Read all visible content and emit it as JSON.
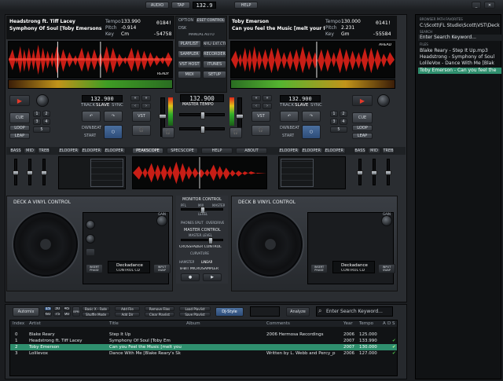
{
  "topbar": {
    "audio": "AUDIO",
    "tap": "TAP",
    "bpm": "132.9",
    "help": "HELP"
  },
  "deckA": {
    "artist": "Headstrong ft. Tiff Lacey",
    "title": "Symphony Of Soul [Toby Emersons Elec",
    "tempo_label": "Tempo",
    "tempo_value": "133.990",
    "pitch_label": "Pitch",
    "pitch_value": "-0.914",
    "key_label": "Key",
    "key_value": "Cm",
    "time1": "0184!",
    "time2": "-54758",
    "ready": "READY",
    "bpm_display": "132.900",
    "track": "TRACK",
    "slave": "SLAVE",
    "sync": "SYNC",
    "cue": "CUE",
    "loop": "LOOP",
    "leap": "LEAP",
    "downbeat": "DWNBEAT",
    "start": "START",
    "vst": "VST",
    "cue_nums": [
      "1",
      "2",
      "3",
      "4",
      "5"
    ]
  },
  "deckB": {
    "artist": "Toby Emerson",
    "title": "Can you feel the Music [melt your face",
    "tempo_label": "Tempo",
    "tempo_value": "130.000",
    "pitch_label": "Pitch",
    "pitch_value": "2.231",
    "key_label": "Key",
    "key_value": "Gm",
    "time1": "0141!",
    "time2": "-55584",
    "ahead": "AHEAD",
    "bpm_display": "132.900",
    "track": "TRACK",
    "slave": "SLAVE",
    "sync": "SYNC",
    "cue": "CUE",
    "loop": "LOOP",
    "leap": "LEAP",
    "downbeat": "DWNBEAT",
    "start": "START",
    "vst": "VST",
    "cue_nums": [
      "1",
      "2",
      "3",
      "4",
      "5"
    ]
  },
  "center": {
    "option": "OPTION",
    "reset": "RESET CONTROLS",
    "dsk": "DSK",
    "manual": "MANUAL",
    "auto": "AUTO",
    "playlist": "PLAYLIST",
    "vinyl": "VINYL/ EXT.CTRL",
    "sampler": "SAMPLER",
    "recorder": "RECORDER",
    "vsthost": "VST HOST",
    "itunes": "ITUNES",
    "midi": "MIDI",
    "setup": "SETUP",
    "master_bpm": "132.900",
    "master_tempo": "MASTER TEMPO"
  },
  "tabs": {
    "left": [
      "BASS",
      "MID",
      "TREB"
    ],
    "relooper": [
      "RELOOPER 1",
      "RELOOPER 2",
      "RELOOPER 3"
    ],
    "middle": [
      "PEAKSCOPE",
      "SPECSCOPE",
      "HELP",
      "ABOUT"
    ],
    "right": [
      "BASS",
      "MID",
      "TREB"
    ]
  },
  "vinylA": {
    "title": "DECK A VINYL CONTROL",
    "gain": "GAIN",
    "insert": "INSERT PHASE",
    "input": "INPUT SWAP",
    "logo1": "Deckadance",
    "logo2": "CONTROL CD"
  },
  "vinylB": {
    "title": "DECK B VINYL CONTROL",
    "gain": "GAIN",
    "insert": "INSERT PHASE",
    "input": "INPUT SWAP",
    "logo1": "Deckadance",
    "logo2": "CONTROL CD"
  },
  "mixer": {
    "monitor": "MONITOR CONTROL",
    "pfl": "PFL",
    "mix": "MIX",
    "master": "MASTER",
    "level": "LEVEL",
    "phones_split": "PHONES SPLIT",
    "overdrive": "OVERDRIVE",
    "master_control": "MASTER CONTROL",
    "master_level": "MASTER LEVEL",
    "crossfader": "CROSSFADER CONTROL",
    "curvature": "CURVATURE",
    "hamster": "HAMSTER",
    "linear": "LINEAR",
    "microsampler": "8-BIT MICROSAMPLER",
    "play": "▶",
    "rec": "●"
  },
  "playlist": {
    "automix": "Automix",
    "nums1": [
      "15",
      "30",
      "45"
    ],
    "nums2": [
      "60",
      "75",
      "90"
    ],
    "bpm_btn": "BPM",
    "basic": "Basic X - Fade",
    "shuffle": "Shuffle Mode",
    "add_file": "Add File",
    "add_dir": "Add Dir",
    "remove": "Remove Files",
    "clear": "Clear Playlist",
    "load": "Load Playlist",
    "save": "Save Playlist",
    "djstyle": "DJ-Style",
    "analyze": "Analyze",
    "search_placeholder": "Enter Search Keyword...",
    "columns": {
      "index": "Index",
      "artist": "Artist",
      "title": "Title",
      "album": "Album",
      "comments": "Comments",
      "year": "Year",
      "tempo": "Tempo",
      "a": "A",
      "d": "D",
      "s": "S"
    },
    "rows": [
      {
        "index": "0",
        "artist": "Blake Reary",
        "title": "Step It Up",
        "album": "",
        "comments": "2006 Hermosa Recordings",
        "year": "2006",
        "tempo": "125.000"
      },
      {
        "index": "1",
        "artist": "Headstrong ft. Tiff Lacey",
        "title": "Symphony Of Soul [Toby Em",
        "album": "",
        "comments": "",
        "year": "2007",
        "tempo": "133.990"
      },
      {
        "index": "2",
        "artist": "Toby Emerson",
        "title": "Can you Feel the Music [melt you",
        "album": "",
        "comments": "",
        "year": "2007",
        "tempo": "130.000"
      },
      {
        "index": "3",
        "artist": "Lolilevox",
        "title": "Dance With Me [Blake Reary's Sk",
        "album": "",
        "comments": "Written by L. Webb and Percy_p",
        "year": "2006",
        "tempo": "127.000"
      }
    ]
  },
  "browser": {
    "header": "BROWSER PATH FAVORITES",
    "path": "C:\\Scott\\FL Studio\\Scott\\VST\\Deck",
    "search_header": "SEARCH",
    "search_placeholder": "Enter Search Keyword...",
    "files_header": "FILES",
    "files": [
      "Blake Reary - Step It Up.mp3",
      "Headstrong - Symphony of Soul",
      "LolileVox - Dance With Me [Blak",
      "Toby Emerson - Can you feel the"
    ]
  },
  "colors": {
    "accent": "#3fbfa0",
    "waveform": "#d7261c",
    "select": "#2f8f6e"
  }
}
